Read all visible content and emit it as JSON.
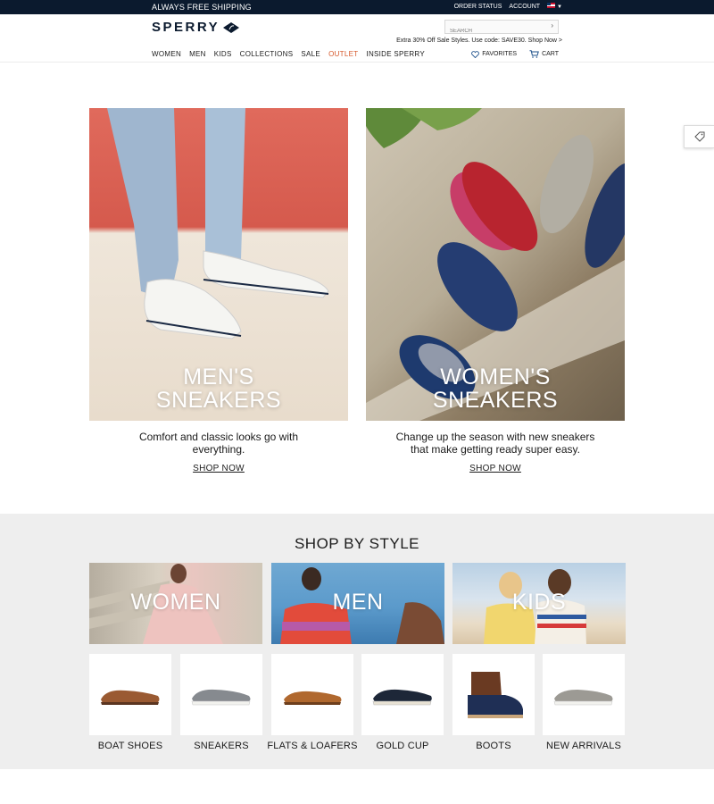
{
  "topbar": {
    "promo": "ALWAYS FREE SHIPPING",
    "order_status": "ORDER STATUS",
    "account": "ACCOUNT"
  },
  "header": {
    "logo_text": "SPERRY",
    "search_placeholder": "SEARCH",
    "promo_line": "Extra 30% Off Sale Styles. Use code: SAVE30. Shop Now >",
    "favorites": "FAVORITES",
    "cart": "CART"
  },
  "nav": {
    "items": [
      "WOMEN",
      "MEN",
      "KIDS",
      "COLLECTIONS",
      "SALE",
      "OUTLET",
      "INSIDE SPERRY"
    ]
  },
  "hero": {
    "men": {
      "title_line1": "MEN'S",
      "title_line2": "SNEAKERS",
      "copy": "Comfort and classic looks go with everything.",
      "cta": "SHOP NOW"
    },
    "women": {
      "title_line1": "WOMEN'S",
      "title_line2": "SNEAKERS",
      "copy": "Change up the season with new sneakers that make getting ready super easy.",
      "cta": "SHOP NOW"
    }
  },
  "shop_by_style": {
    "heading": "SHOP BY STYLE",
    "categories": [
      "WOMEN",
      "MEN",
      "KIDS"
    ],
    "styles": [
      "BOAT SHOES",
      "SNEAKERS",
      "FLATS & LOAFERS",
      "GOLD CUP",
      "BOOTS",
      "NEW ARRIVALS"
    ]
  },
  "colors": {
    "navy": "#0b1a2e",
    "outlet": "#d6582b",
    "section_bg": "#eeeeee"
  }
}
